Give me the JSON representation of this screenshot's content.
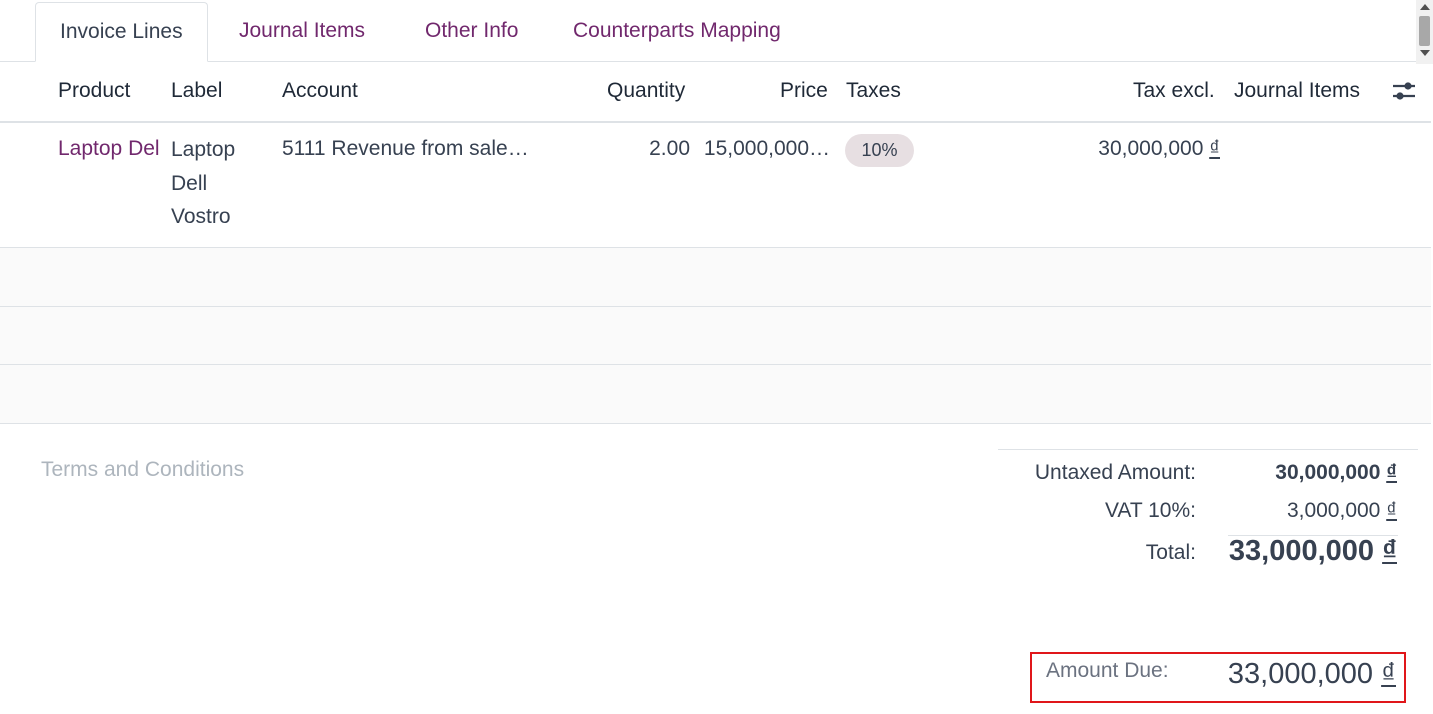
{
  "tabs": {
    "invoice_lines": "Invoice Lines",
    "journal_items": "Journal Items",
    "other_info": "Other Info",
    "counterparts_mapping": "Counterparts Mapping"
  },
  "table": {
    "headers": {
      "product": "Product",
      "label": "Label",
      "account": "Account",
      "quantity": "Quantity",
      "price": "Price",
      "taxes": "Taxes",
      "tax_excl": "Tax excl.",
      "journal_items": "Journal Items"
    },
    "rows": [
      {
        "product": "Laptop Del",
        "label": "Laptop Dell Vostro",
        "account": "5111 Revenue from sale…",
        "quantity": "2.00",
        "price": "15,000,000…",
        "tax": "10%",
        "tax_excl": "30,000,000",
        "currency": "₫"
      }
    ]
  },
  "footer": {
    "terms_placeholder": "Terms and Conditions",
    "untaxed_label": "Untaxed Amount:",
    "untaxed_value": "30,000,000",
    "vat_label": "VAT 10%:",
    "vat_value": "3,000,000",
    "total_label": "Total:",
    "total_value": "33,000,000",
    "amount_due_label": "Amount Due:",
    "amount_due_value": "33,000,000",
    "currency": "₫"
  },
  "colors": {
    "accent": "#71286d",
    "highlight_border": "#e0161a",
    "tax_badge_bg": "#e7dfe2"
  },
  "icons": {
    "column_settings": "sliders-icon"
  }
}
